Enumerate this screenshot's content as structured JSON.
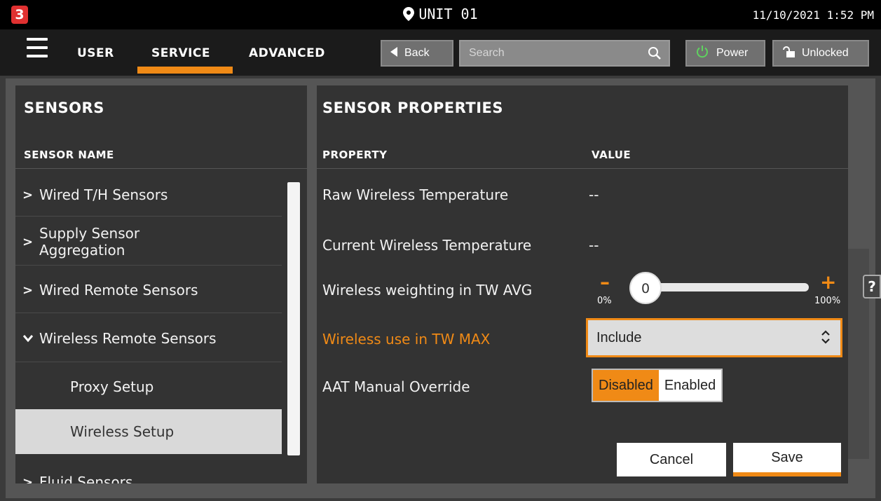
{
  "topbar": {
    "logo": "3",
    "unit": "UNIT 01",
    "datetime": "11/10/2021 1:52 PM"
  },
  "nav": {
    "tabs": [
      "USER",
      "SERVICE",
      "ADVANCED"
    ],
    "active_tab": "SERVICE",
    "back_label": "Back",
    "search_placeholder": "Search",
    "power_label": "Power",
    "unlocked_label": "Unlocked"
  },
  "sensors": {
    "title": "SENSORS",
    "column": "SENSOR NAME",
    "items": [
      {
        "label": "Wired T/H Sensors",
        "chevron": "›"
      },
      {
        "label": "Supply Sensor Aggregation",
        "chevron": "›"
      },
      {
        "label": "Wired Remote Sensors",
        "chevron": "›"
      },
      {
        "label": "Wireless Remote Sensors",
        "chevron": "⌄"
      },
      {
        "label": "Proxy Setup"
      },
      {
        "label": "Wireless Setup",
        "selected": true
      },
      {
        "label": "Fluid Sensors",
        "chevron": "›"
      }
    ]
  },
  "properties": {
    "title": "SENSOR PROPERTIES",
    "col_property": "PROPERTY",
    "col_value": "VALUE",
    "rows": [
      {
        "label": "Raw Wireless Temperature",
        "value": "--"
      },
      {
        "label": "Current Wireless Temperature",
        "value": "--"
      },
      {
        "label": "Wireless weighting in TW AVG",
        "value": "0"
      },
      {
        "label": "Wireless use in TW MAX",
        "value": "Include"
      },
      {
        "label": "AAT Manual Override"
      }
    ],
    "slider": {
      "value": "0",
      "min_label": "0%",
      "max_label": "100%",
      "fraction": 0
    },
    "toggle": {
      "disabled": "Disabled",
      "enabled": "Enabled",
      "selected": "Disabled"
    },
    "cancel_label": "Cancel",
    "save_label": "Save"
  },
  "help_label": "?",
  "colors": {
    "accent": "#f08a16",
    "panel": "#333333",
    "background": "#000000"
  }
}
